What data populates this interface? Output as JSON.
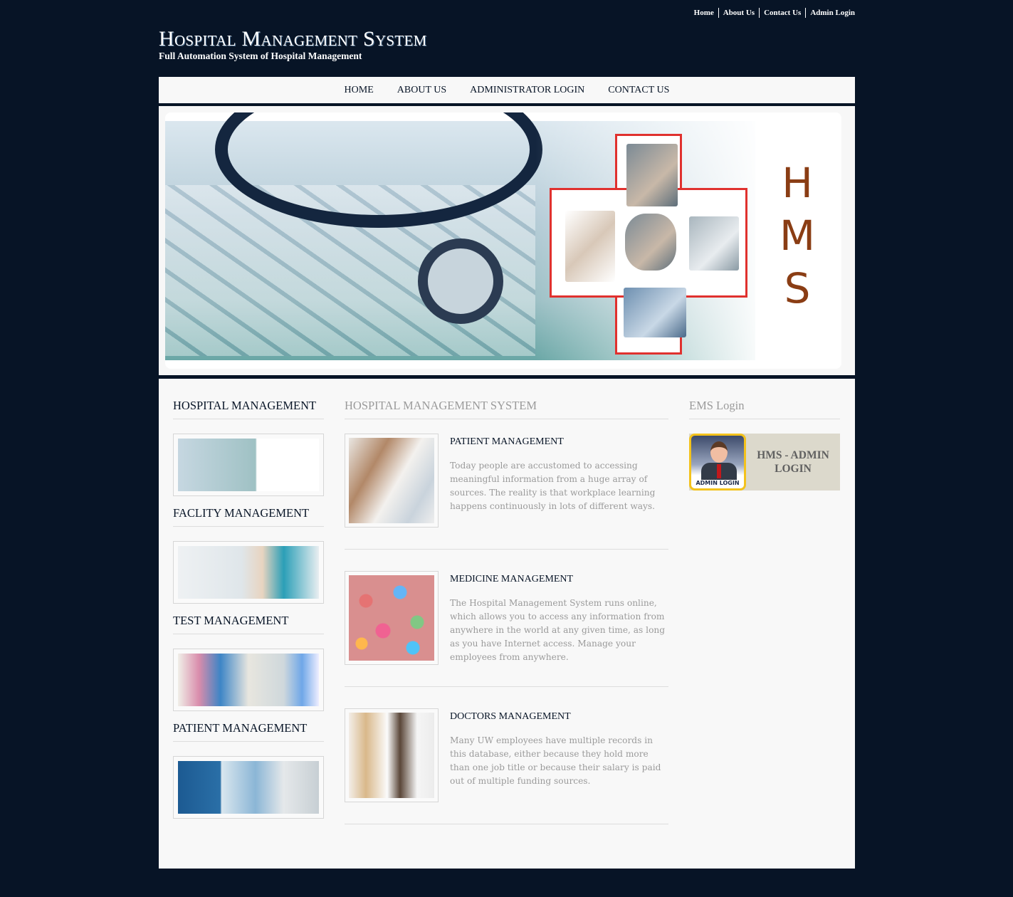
{
  "top_links": [
    "Home",
    "About Us",
    "Contact Us",
    "Admin Login"
  ],
  "header": {
    "title": "Hospital Management System",
    "subtitle": "Full Automation System of Hospital Management"
  },
  "nav": [
    "HOME",
    "ABOUT US",
    "ADMINISTRATOR LOGIN",
    "CONTACT US"
  ],
  "banner": {
    "letters": [
      "H",
      "M",
      "S"
    ]
  },
  "sidebar": {
    "sections": [
      {
        "title": "HOSPITAL MANAGEMENT"
      },
      {
        "title": "FACLITY MANAGEMENT"
      },
      {
        "title": "TEST MANAGEMENT"
      },
      {
        "title": "PATIENT MANAGEMENT"
      }
    ]
  },
  "main": {
    "heading": "HOSPITAL MANAGEMENT SYSTEM",
    "items": [
      {
        "title": "PATIENT MANAGEMENT",
        "text": "Today people are accustomed to accessing meaningful information from a huge array of sources. The reality is that workplace learning happens continuously in lots of different ways."
      },
      {
        "title": "MEDICINE MANAGEMENT",
        "text": "The Hospital Management System runs online, which allows you to access any information from anywhere in the world at any given time, as long as you have Internet access. Manage your employees from anywhere."
      },
      {
        "title": "DOCTORS MANAGEMENT",
        "text": "Many UW employees have multiple records in this database, either because they hold more than one job title or because their salary is paid out of multiple funding sources."
      }
    ]
  },
  "right": {
    "heading": "EMS Login",
    "admin_icon_label": "ADMIN LOGIN",
    "admin_button": "HMS - ADMIN LOGIN"
  },
  "colors": {
    "page_bg": "#071426",
    "content_bg": "#f8f8f8",
    "admin_box_bg": "#dcd9cc",
    "cross_red": "#e0312e",
    "hms_brown": "#8a3d14"
  }
}
